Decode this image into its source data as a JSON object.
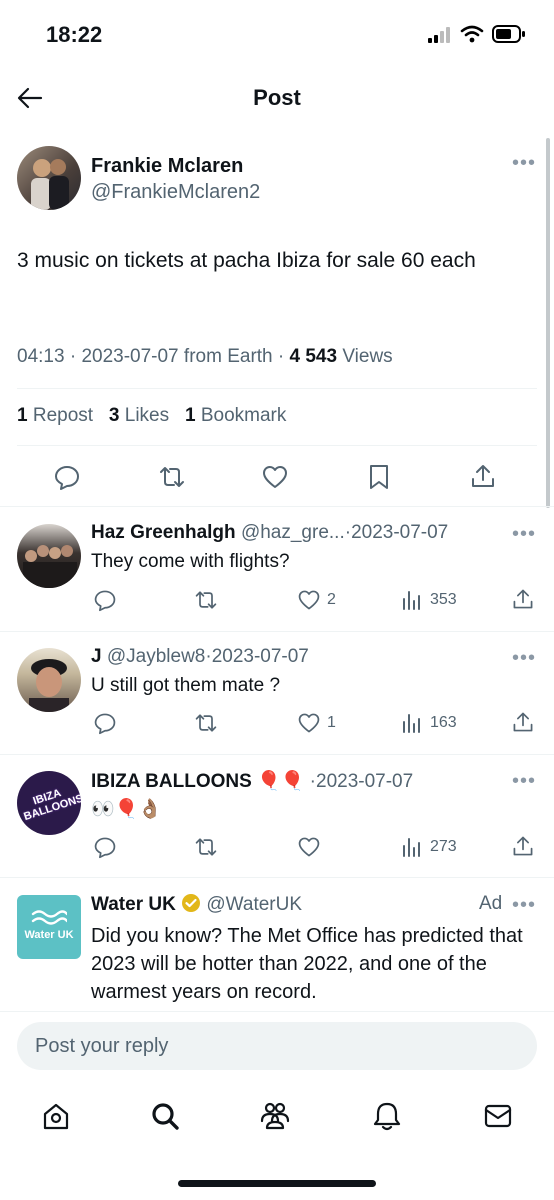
{
  "status_bar": {
    "time": "18:22"
  },
  "header": {
    "title": "Post"
  },
  "post": {
    "author_name": "Frankie Mclaren",
    "author_handle": "@FrankieMclaren2",
    "text": "3 music on tickets at pacha Ibiza for sale 60 each",
    "time": "04:13",
    "date": "2023-07-07",
    "source": "from Earth",
    "views_count": "4 543",
    "views_label": "Views",
    "reposts_count": "1",
    "reposts_label": "Repost",
    "likes_count": "3",
    "likes_label": "Likes",
    "bookmarks_count": "1",
    "bookmarks_label": "Bookmark"
  },
  "replies": [
    {
      "name": "Haz Greenhalgh",
      "handle": "@haz_gre...",
      "date": "2023-07-07",
      "text": "They come with flights?",
      "likes": "2",
      "views": "353"
    },
    {
      "name": "J",
      "handle": "@Jayblew8",
      "date": "2023-07-07",
      "text": "U still got them mate ?",
      "likes": "1",
      "views": "163"
    },
    {
      "name": "IBIZA BALLOONS 🎈🎈",
      "handle": "",
      "date": "2023-07-07",
      "text": "👀🎈👌🏽",
      "likes": "",
      "views": "273",
      "avatar_text": "IBIZA BALLOONS"
    }
  ],
  "ad": {
    "name": "Water UK",
    "handle": "@WaterUK",
    "ad_label": "Ad",
    "avatar_text": "Water UK",
    "text": "Did you know? The Met Office has predicted that 2023 will be hotter than 2022, and one of the warmest years on record."
  },
  "reply_box": {
    "placeholder": "Post your reply"
  },
  "bottom_nav": [
    "home-icon",
    "search-icon",
    "communities-icon",
    "notifications-icon",
    "messages-icon"
  ],
  "colors": {
    "accent": "#1d9bf0",
    "text": "#0f1419",
    "secondary": "#536471",
    "water_uk": "#5cc1c5",
    "verified": "#e2b719"
  }
}
